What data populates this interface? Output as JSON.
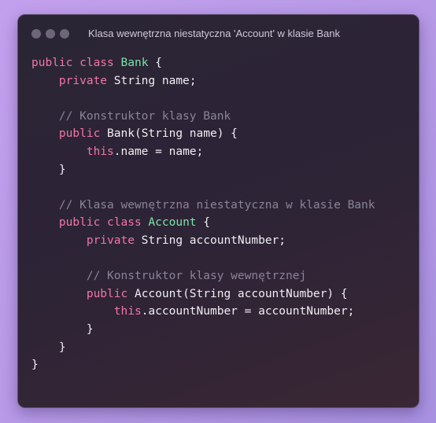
{
  "window": {
    "title": "Klasa wewnętrzna niestatyczna 'Account' w klasie Bank"
  },
  "code_lines": [
    [
      {
        "t": "public class ",
        "c": "kw"
      },
      {
        "t": "Bank",
        "c": "cls"
      },
      {
        "t": " {",
        "c": ""
      }
    ],
    [
      {
        "t": "    ",
        "c": ""
      },
      {
        "t": "private",
        "c": "kw"
      },
      {
        "t": " String name;",
        "c": ""
      }
    ],
    [],
    [
      {
        "t": "    // Konstruktor klasy Bank",
        "c": "cmt"
      }
    ],
    [
      {
        "t": "    ",
        "c": ""
      },
      {
        "t": "public",
        "c": "kw"
      },
      {
        "t": " Bank(String name) {",
        "c": ""
      }
    ],
    [
      {
        "t": "        ",
        "c": ""
      },
      {
        "t": "this",
        "c": "kw"
      },
      {
        "t": ".name = name;",
        "c": ""
      }
    ],
    [
      {
        "t": "    }",
        "c": ""
      }
    ],
    [],
    [
      {
        "t": "    // Klasa wewnętrzna niestatyczna w klasie Bank",
        "c": "cmt"
      }
    ],
    [
      {
        "t": "    ",
        "c": ""
      },
      {
        "t": "public class ",
        "c": "kw"
      },
      {
        "t": "Account",
        "c": "cls"
      },
      {
        "t": " {",
        "c": ""
      }
    ],
    [
      {
        "t": "        ",
        "c": ""
      },
      {
        "t": "private",
        "c": "kw"
      },
      {
        "t": " String accountNumber;",
        "c": ""
      }
    ],
    [],
    [
      {
        "t": "        // Konstruktor klasy wewnętrznej",
        "c": "cmt"
      }
    ],
    [
      {
        "t": "        ",
        "c": ""
      },
      {
        "t": "public",
        "c": "kw"
      },
      {
        "t": " Account(String accountNumber) {",
        "c": ""
      }
    ],
    [
      {
        "t": "            ",
        "c": ""
      },
      {
        "t": "this",
        "c": "kw"
      },
      {
        "t": ".accountNumber = accountNumber;",
        "c": ""
      }
    ],
    [
      {
        "t": "        }",
        "c": ""
      }
    ],
    [
      {
        "t": "    }",
        "c": ""
      }
    ],
    [
      {
        "t": "}",
        "c": ""
      }
    ]
  ]
}
